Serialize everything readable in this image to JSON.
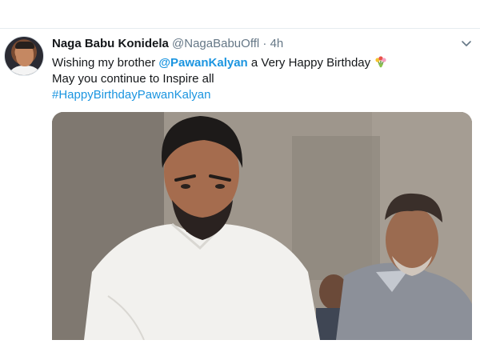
{
  "tweet": {
    "display_name": "Naga Babu Konidela",
    "handle": "@NagaBabuOffl",
    "separator": "·",
    "time": "4h",
    "text_line1_prefix": "Wishing my brother ",
    "mention": "@PawanKalyan",
    "text_line1_suffix": " a Very Happy Birthday",
    "text_line2": "May you continue to Inspire all",
    "hashtag": "#HappyBirthdayPawanKalyan",
    "emoji_icon": "bouquet-icon",
    "menu_icon": "chevron-down-icon"
  },
  "colors": {
    "link": "#1b95e0",
    "secondary_text": "#657786",
    "primary_text": "#14171a"
  }
}
